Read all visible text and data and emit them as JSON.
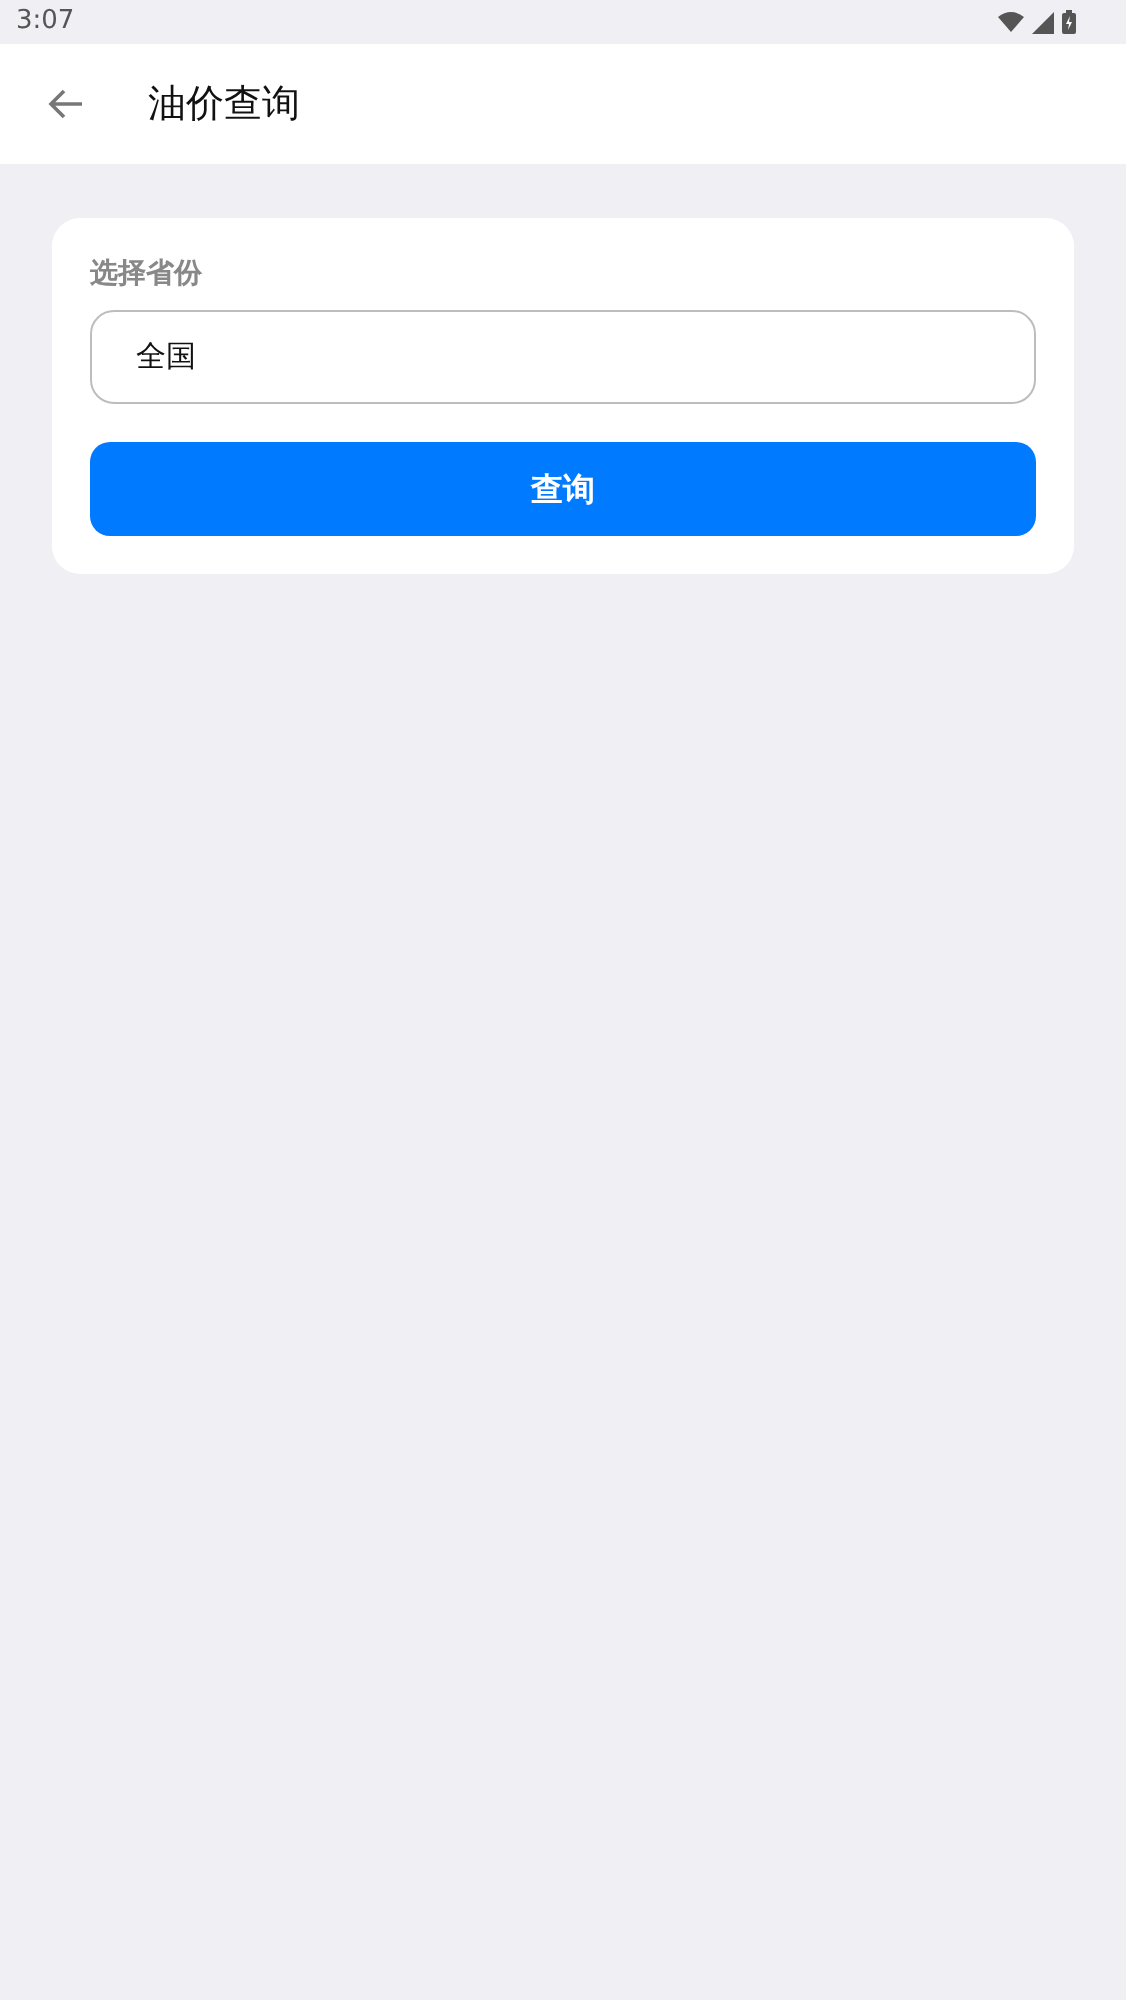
{
  "status_bar": {
    "time": "3:07"
  },
  "app_bar": {
    "title": "油价查询"
  },
  "form": {
    "label": "选择省份",
    "value": "全国",
    "button": "查询"
  }
}
